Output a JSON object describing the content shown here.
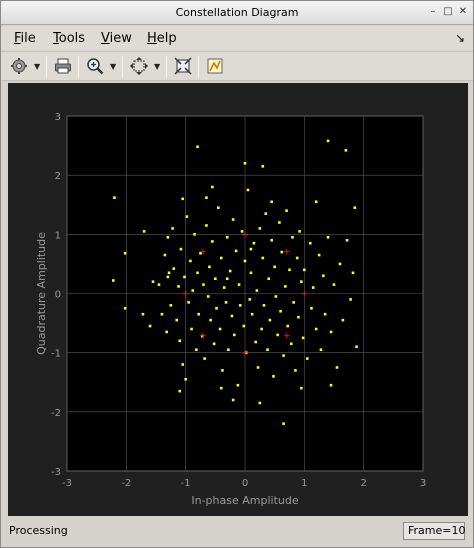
{
  "window": {
    "title": "Constellation Diagram"
  },
  "menu": {
    "items": [
      {
        "label": "File",
        "u": "F",
        "rest": "ile"
      },
      {
        "label": "Tools",
        "u": "T",
        "rest": "ools"
      },
      {
        "label": "View",
        "u": "V",
        "rest": "iew"
      },
      {
        "label": "Help",
        "u": "H",
        "rest": "elp"
      }
    ]
  },
  "toolbar": {
    "buttons": [
      "settings-icon",
      "print-icon",
      "zoom-in-icon",
      "pan-icon",
      "autoscale-icon",
      "measurement-icon"
    ]
  },
  "status": {
    "text": "Processing",
    "frame": "Frame=10"
  },
  "colors": {
    "plot_background": "#202020",
    "symbol_color": "#ffff00",
    "reference_color": "#ff2020",
    "grid_color": "#5a5a5a",
    "axis_text": "#9a9a9a"
  },
  "chart_data": {
    "type": "scatter",
    "xlabel": "In-phase Amplitude",
    "ylabel": "Quadrature Amplitude",
    "xlim": [
      -3,
      3
    ],
    "ylim": [
      -3,
      3
    ],
    "xticks": [
      -3,
      -2,
      -1,
      0,
      1,
      2,
      3
    ],
    "yticks": [
      -3,
      -2,
      -1,
      0,
      1,
      2,
      3
    ],
    "grid": true,
    "series": [
      {
        "role": "received-symbols",
        "color": "#ffff00",
        "points": [
          [
            -2.2,
            1.62
          ],
          [
            -2.22,
            0.22
          ],
          [
            -2.02,
            0.68
          ],
          [
            -2.02,
            -0.25
          ],
          [
            -1.7,
            1.05
          ],
          [
            -1.72,
            -0.35
          ],
          [
            -1.6,
            -0.55
          ],
          [
            -1.55,
            0.2
          ],
          [
            -1.45,
            0.15
          ],
          [
            -1.4,
            -0.35
          ],
          [
            -1.35,
            0.65
          ],
          [
            -1.32,
            -0.65
          ],
          [
            -1.3,
            0.95
          ],
          [
            -1.28,
            0.35
          ],
          [
            -1.25,
            -0.2
          ],
          [
            -1.22,
            1.1
          ],
          [
            -1.2,
            0.42
          ],
          [
            -1.15,
            -0.45
          ],
          [
            -1.12,
            0.12
          ],
          [
            -1.1,
            -0.8
          ],
          [
            -1.08,
            0.75
          ],
          [
            -1.05,
            -1.2
          ],
          [
            -1.02,
            0.28
          ],
          [
            -1.0,
            -1.45
          ],
          [
            -0.98,
            1.3
          ],
          [
            -0.95,
            -0.15
          ],
          [
            -0.92,
            0.55
          ],
          [
            -0.9,
            -0.6
          ],
          [
            -0.88,
            0.05
          ],
          [
            -0.85,
            1.0
          ],
          [
            -0.82,
            -0.95
          ],
          [
            -0.8,
            0.35
          ],
          [
            -0.78,
            -0.35
          ],
          [
            -0.75,
            0.68
          ],
          [
            -0.72,
            -0.72
          ],
          [
            -0.7,
            0.15
          ],
          [
            -0.68,
            -1.1
          ],
          [
            -0.65,
            1.15
          ],
          [
            -0.62,
            -0.05
          ],
          [
            -0.6,
            0.45
          ],
          [
            -0.58,
            -0.45
          ],
          [
            -0.55,
            0.88
          ],
          [
            -0.52,
            -0.85
          ],
          [
            -0.5,
            0.25
          ],
          [
            -0.48,
            -0.25
          ],
          [
            -0.45,
            1.45
          ],
          [
            -0.42,
            -0.6
          ],
          [
            -0.4,
            0.6
          ],
          [
            -0.38,
            -1.3
          ],
          [
            -0.35,
            0.1
          ],
          [
            -0.32,
            -0.15
          ],
          [
            -0.3,
            0.95
          ],
          [
            -0.28,
            -0.95
          ],
          [
            -0.25,
            0.38
          ],
          [
            -0.22,
            -0.38
          ],
          [
            -0.2,
            1.25
          ],
          [
            -0.18,
            -0.7
          ],
          [
            -0.15,
            0.72
          ],
          [
            -0.12,
            -1.55
          ],
          [
            -0.1,
            0.15
          ],
          [
            -0.08,
            -0.2
          ],
          [
            -0.05,
            1.05
          ],
          [
            -0.02,
            -0.55
          ],
          [
            0.0,
            0.55
          ],
          [
            0.02,
            -1.0
          ],
          [
            0.05,
            1.75
          ],
          [
            0.08,
            -0.1
          ],
          [
            0.1,
            0.35
          ],
          [
            0.12,
            -0.35
          ],
          [
            0.15,
            0.85
          ],
          [
            0.18,
            -0.82
          ],
          [
            0.2,
            0.05
          ],
          [
            0.22,
            -1.25
          ],
          [
            0.25,
            1.1
          ],
          [
            0.28,
            -0.6
          ],
          [
            0.3,
            0.6
          ],
          [
            0.32,
            -0.2
          ],
          [
            0.35,
            1.35
          ],
          [
            0.38,
            -0.95
          ],
          [
            0.4,
            0.25
          ],
          [
            0.42,
            -0.45
          ],
          [
            0.45,
            0.9
          ],
          [
            0.48,
            -1.4
          ],
          [
            0.5,
            0.45
          ],
          [
            0.52,
            -0.05
          ],
          [
            0.55,
            -0.7
          ],
          [
            0.58,
            1.2
          ],
          [
            0.6,
            -0.3
          ],
          [
            0.62,
            0.7
          ],
          [
            0.65,
            -1.05
          ],
          [
            0.68,
            0.12
          ],
          [
            0.7,
            1.4
          ],
          [
            0.72,
            -0.55
          ],
          [
            0.75,
            0.4
          ],
          [
            0.78,
            -0.85
          ],
          [
            0.8,
            0.95
          ],
          [
            0.82,
            -0.15
          ],
          [
            0.85,
            -1.3
          ],
          [
            0.88,
            0.6
          ],
          [
            0.9,
            -0.4
          ],
          [
            0.92,
            1.05
          ],
          [
            0.95,
            0.2
          ],
          [
            0.98,
            -0.75
          ],
          [
            1.0,
            0.4
          ],
          [
            1.05,
            -1.1
          ],
          [
            1.1,
            0.85
          ],
          [
            1.12,
            -0.25
          ],
          [
            1.15,
            0.1
          ],
          [
            1.2,
            -0.6
          ],
          [
            1.25,
            0.65
          ],
          [
            1.28,
            -0.95
          ],
          [
            1.32,
            0.3
          ],
          [
            1.35,
            -0.35
          ],
          [
            1.4,
            0.95
          ],
          [
            1.45,
            -0.65
          ],
          [
            1.5,
            0.15
          ],
          [
            1.55,
            -1.25
          ],
          [
            1.6,
            0.5
          ],
          [
            1.65,
            -0.45
          ],
          [
            1.72,
            0.9
          ],
          [
            1.78,
            -0.1
          ],
          [
            1.82,
            0.35
          ],
          [
            1.88,
            -0.9
          ],
          [
            1.85,
            1.45
          ],
          [
            1.4,
            2.58
          ],
          [
            1.7,
            2.42
          ],
          [
            0.3,
            2.15
          ],
          [
            -0.8,
            2.48
          ],
          [
            -0.55,
            1.8
          ],
          [
            0.65,
            -2.2
          ],
          [
            1.45,
            -1.55
          ],
          [
            -1.1,
            -1.65
          ],
          [
            0.95,
            -1.6
          ],
          [
            -0.2,
            -1.8
          ],
          [
            0.25,
            -1.85
          ],
          [
            -1.3,
            0.28
          ],
          [
            -0.65,
            1.62
          ],
          [
            0.45,
            1.55
          ],
          [
            1.2,
            1.55
          ],
          [
            -1.05,
            1.6
          ],
          [
            0.0,
            2.2
          ],
          [
            -0.4,
            -1.6
          ],
          [
            0.1,
            0.75
          ],
          [
            -0.3,
            0.25
          ]
        ]
      },
      {
        "role": "reference-constellation",
        "color": "#ff2020",
        "points": [
          [
            0.0,
            1.0
          ],
          [
            0.707,
            0.707
          ],
          [
            1.0,
            0.0
          ],
          [
            0.707,
            -0.707
          ],
          [
            0.0,
            -1.0
          ],
          [
            -0.707,
            -0.707
          ],
          [
            -1.0,
            0.0
          ],
          [
            -0.707,
            0.707
          ]
        ]
      }
    ]
  }
}
